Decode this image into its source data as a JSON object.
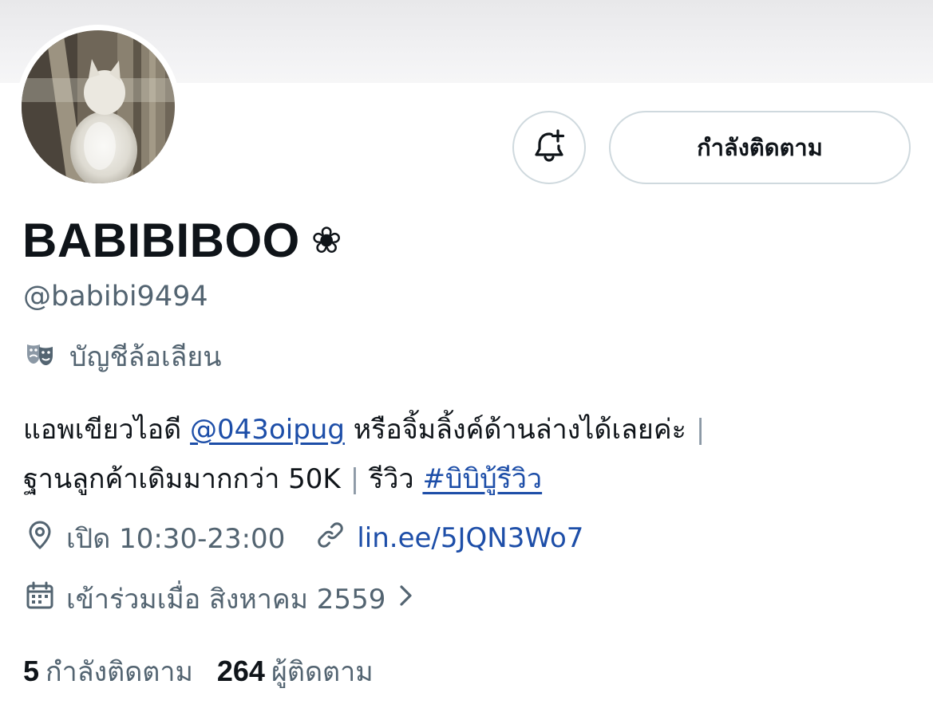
{
  "profile": {
    "display_name": "BABIBIBOO",
    "name_emoji": "❀",
    "handle": "@babibi9494",
    "parody_label": "บัญชีล้อเลียน",
    "follow_button_label": "กำลังติดตาม"
  },
  "bio": {
    "line1_prefix": "แอพเขียวไอดี",
    "mention": "@043oipug",
    "line1_suffix": "หรือจิ้มลิ้งค์ด้านล่างได้เลยค่ะ",
    "separator": "|",
    "line2_prefix": "ฐานลูกค้าเดิมมากกว่า 50K",
    "line2_review": "รีวิว",
    "hashtag": "#บิบิบู้รีวิว"
  },
  "meta": {
    "location": "เปิด 10:30-23:00",
    "website": "lin.ee/5JQN3Wo7",
    "joined": "เข้าร่วมเมื่อ สิงหาคม 2559"
  },
  "stats": {
    "following_count": "5",
    "following_label": "กำลังติดตาม",
    "followers_count": "264",
    "followers_label": "ผู้ติดตาม"
  },
  "colors": {
    "link": "#1d4ea8",
    "secondary_text": "#536471",
    "border": "#cfd9de"
  },
  "icons": {
    "notify": "bell-plus-icon",
    "parody": "theater-masks-icon",
    "location": "location-pin-icon",
    "website": "link-icon",
    "joined": "calendar-icon",
    "joined_chevron": "chevron-right-icon"
  }
}
